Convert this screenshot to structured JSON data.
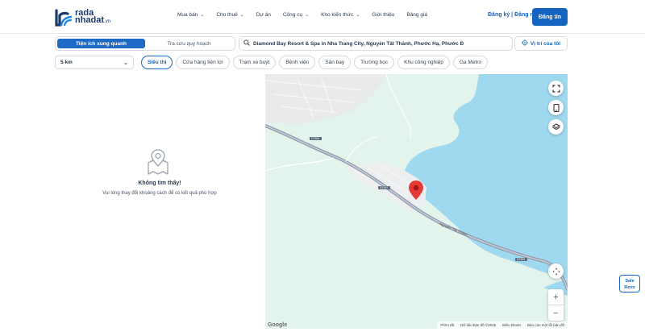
{
  "brand": {
    "line1": "rada",
    "line2": "nhadat",
    "suffix": ".vn",
    "color": "#1a3a6b"
  },
  "nav": [
    {
      "label": "Mua bán",
      "has_dropdown": true
    },
    {
      "label": "Cho thuê",
      "has_dropdown": true
    },
    {
      "label": "Dự án",
      "has_dropdown": false
    },
    {
      "label": "Công cụ",
      "has_dropdown": true
    },
    {
      "label": "Kho kiến thức",
      "has_dropdown": true
    },
    {
      "label": "Giới thiệu",
      "has_dropdown": false
    },
    {
      "label": "Bảng giá",
      "has_dropdown": false
    }
  ],
  "auth": {
    "text": "Đăng ký | Đăng nhập"
  },
  "post_button": {
    "label": "Đăng tin",
    "color": "#1565c0"
  },
  "tabs": {
    "active": "Tiện ích xung quanh",
    "inactive": "Tra cứu quy hoạch"
  },
  "address": {
    "icon": "search-icon",
    "value": "Diamond Bay Resort & Spa in Nha Trang City, Nguyễn Tất Thành, Phước Hạ, Phước Đ"
  },
  "my_location": {
    "label": "Vị trí của tôi",
    "icon": "crosshair-icon"
  },
  "radius": {
    "value": "5 km"
  },
  "chips": [
    {
      "label": "Siêu thị",
      "active": true
    },
    {
      "label": "Cửa hàng tiện lợi",
      "active": false
    },
    {
      "label": "Trạm xe buýt",
      "active": false
    },
    {
      "label": "Bệnh viện",
      "active": false
    },
    {
      "label": "Sân bay",
      "active": false
    },
    {
      "label": "Trường học",
      "active": false
    },
    {
      "label": "Khu công nghiệp",
      "active": false
    },
    {
      "label": "Ga Metro",
      "active": false
    }
  ],
  "empty": {
    "title": "Không tìm thấy!",
    "subtitle": "Vui lòng thay đổi khoảng cách để có kết quả phù hợp"
  },
  "map": {
    "road_name": "Nguyễn Tất Thành",
    "route_badges": [
      "DT651",
      "DT657",
      "DT651"
    ],
    "attribution": [
      "Phím tắt",
      "Dữ liệu bản đồ ©2025",
      "Điều khoản",
      "Báo cáo một lỗi bản đồ"
    ],
    "google": "Google",
    "zoom_in": "+",
    "zoom_out": "−",
    "water_color": "#9fd9ef",
    "land_color": "#e3f4ec",
    "pin_color": "#e53935"
  },
  "sale_widget": {
    "line1": "Sale",
    "line2": "Revo"
  }
}
